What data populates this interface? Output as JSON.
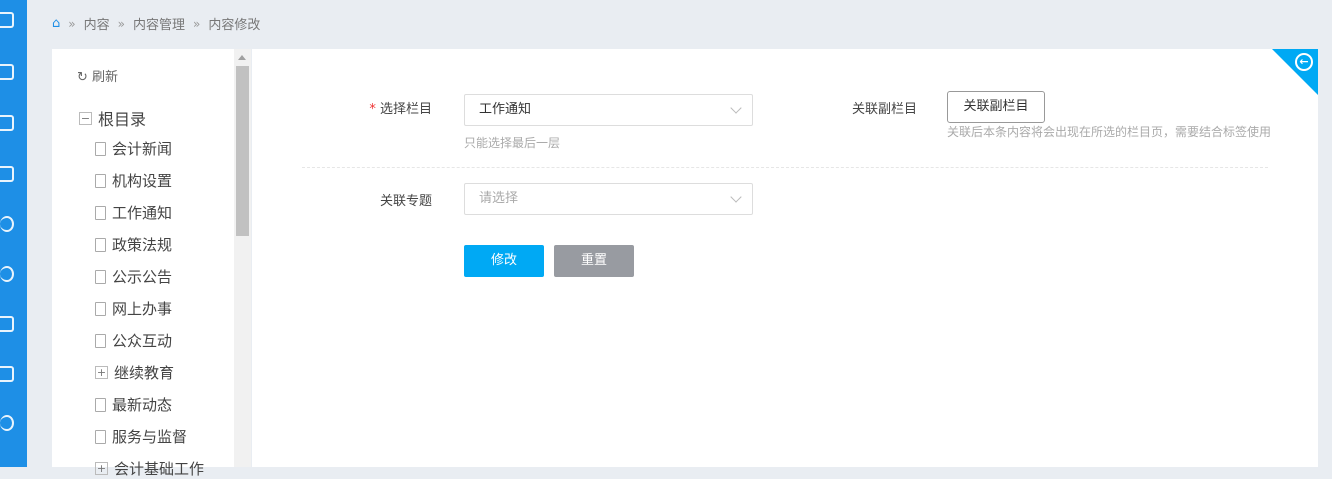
{
  "breadcrumb": [
    "内容",
    "内容管理",
    "内容修改"
  ],
  "tree": {
    "refresh": "刷新",
    "root": "根目录",
    "items": [
      {
        "label": "会计新闻",
        "type": "doc"
      },
      {
        "label": "机构设置",
        "type": "doc"
      },
      {
        "label": "工作通知",
        "type": "doc"
      },
      {
        "label": "政策法规",
        "type": "doc"
      },
      {
        "label": "公示公告",
        "type": "doc"
      },
      {
        "label": "网上办事",
        "type": "doc"
      },
      {
        "label": "公众互动",
        "type": "doc"
      },
      {
        "label": "继续教育",
        "type": "folder"
      },
      {
        "label": "最新动态",
        "type": "doc"
      },
      {
        "label": "服务与监督",
        "type": "doc"
      },
      {
        "label": "会计基础工作",
        "type": "folder"
      }
    ]
  },
  "form": {
    "column_label": "选择栏目",
    "column_value": "工作通知",
    "column_hint": "只能选择最后一层",
    "sub_label": "关联副栏目",
    "sub_button": "关联副栏目",
    "sub_hint": "关联后本条内容将会出现在所选的栏目页，需要结合标签使用",
    "topic_label": "关联专题",
    "topic_placeholder": "请选择",
    "submit": "修改",
    "reset": "重置"
  },
  "colors": {
    "accent": "#00a9f4",
    "rail": "#1e8fe6"
  }
}
